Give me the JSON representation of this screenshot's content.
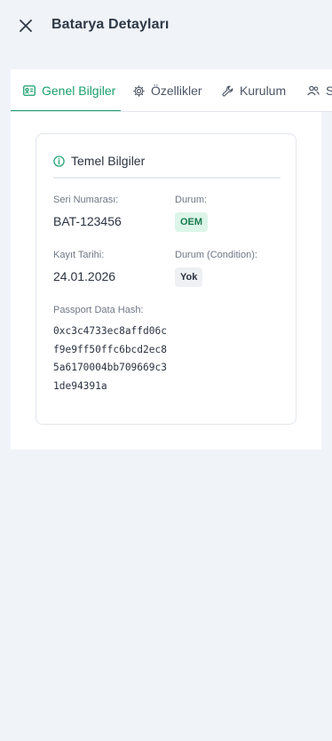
{
  "header": {
    "title": "Batarya Detayları"
  },
  "tabs": [
    {
      "label": "Genel Bilgiler",
      "icon": "id-card-icon",
      "active": true
    },
    {
      "label": "Özellikler",
      "icon": "gear-icon",
      "active": false
    },
    {
      "label": "Kurulum",
      "icon": "wrench-icon",
      "active": false
    },
    {
      "label": "St",
      "icon": "users-icon",
      "active": false
    }
  ],
  "card": {
    "title": "Temel Bilgiler",
    "fields": {
      "serial_label": "Seri Numarası:",
      "serial_value": "BAT-123456",
      "status_label": "Durum:",
      "status_value": "OEM",
      "date_label": "Kayıt Tarihi:",
      "date_value": "24.01.2026",
      "condition_label": "Durum (Condition):",
      "condition_value": "Yok",
      "hash_label": "Passport Data Hash:",
      "hash_value": "0xc3c4733ec8affd06cf9e9ff50ffc6bcd2ec85a6170004bb709669c31de94391a"
    }
  },
  "colors": {
    "accent": "#1aa06d",
    "badge_green_bg": "#dcf5e8",
    "badge_gray_bg": "#eef0f3",
    "page_bg": "#f0f3f8"
  }
}
